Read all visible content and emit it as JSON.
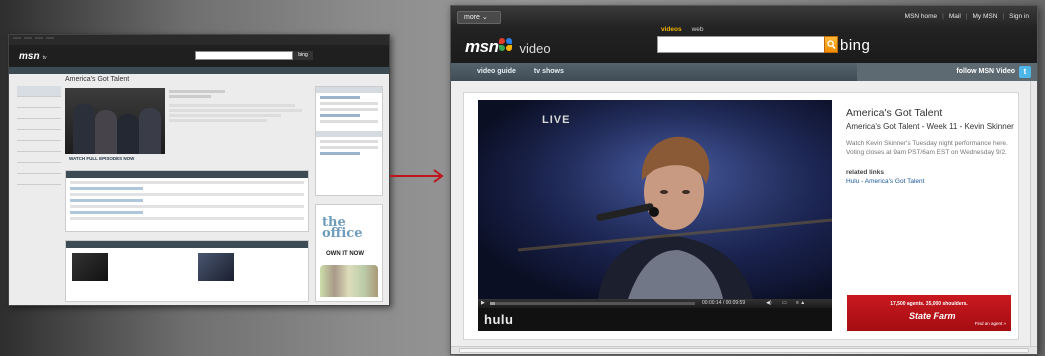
{
  "left": {
    "tabs": [
      "",
      "",
      "",
      "",
      "",
      ""
    ],
    "logo": "msn",
    "logo_sub": "tv",
    "search_button": "bing",
    "page_title": "America's Got Talent",
    "watch_label": "WATCH FULL EPISODES NOW",
    "ad_title": "the office",
    "ad_sub": "OWN IT NOW"
  },
  "header": {
    "more_label": "more",
    "top_links": [
      "MSN home",
      "Mail",
      "My MSN",
      "Sign in"
    ],
    "logo_text": "msn",
    "section_label": "video",
    "search_tabs": [
      "videos",
      "web"
    ],
    "search_value": "",
    "search_button": "bing",
    "colors": {
      "accent": "#f4b400",
      "butterfly": [
        "#e23c2a",
        "#2a7de1",
        "#f7b500",
        "#36a852"
      ]
    }
  },
  "nav": {
    "items": [
      "video guide",
      "tv shows"
    ],
    "follow_label": "follow MSN Video",
    "follow_icon": "t"
  },
  "player": {
    "overlay_text": "LIVE",
    "time": "00:00:14 / 00:09:59",
    "progress_fraction": 0.0234,
    "brand": "hulu"
  },
  "info": {
    "title": "America's Got Talent",
    "subtitle": "America's Got Talent - Week 11 - Kevin Skinner",
    "description": "Watch Kevin Skinner's Tuesday night performance here. Voting closes at 9am PST/6am EST on Wednesday 9/2.",
    "related_label": "related links",
    "related_link": "Hulu - America's Got Talent"
  },
  "ad": {
    "headline": "17,500 agents. 35,000 shoulders.",
    "brand": "State Farm",
    "cta": "Find an agent »"
  }
}
